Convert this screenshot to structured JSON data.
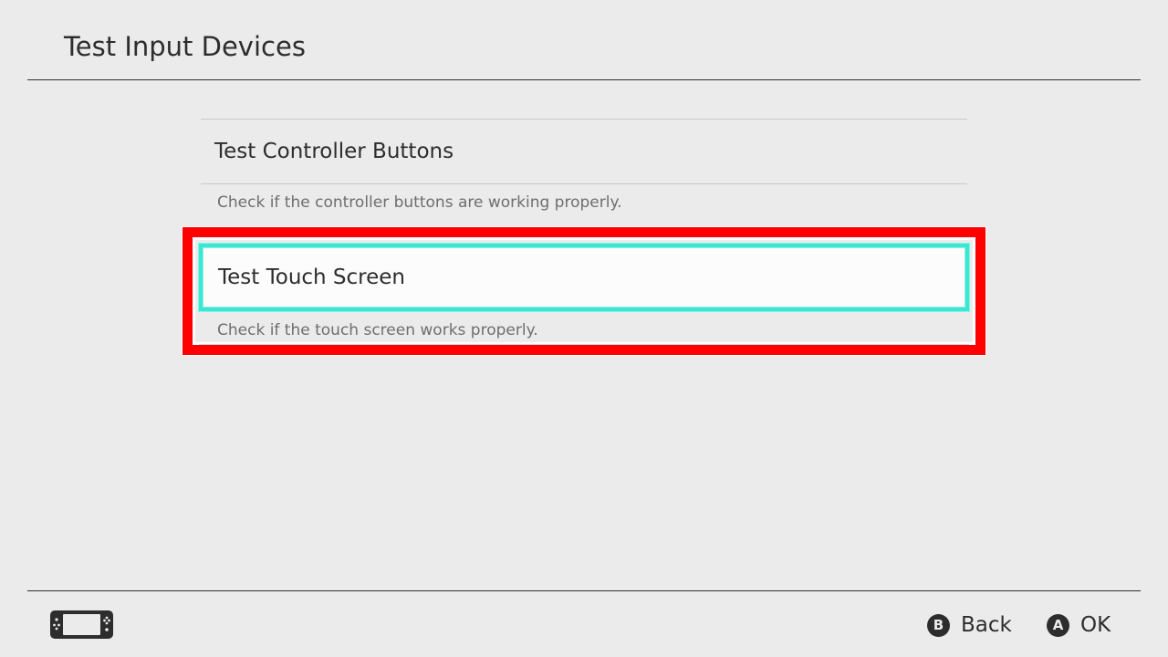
{
  "header": {
    "title": "Test Input Devices"
  },
  "menu": {
    "items": [
      {
        "label": "Test Controller Buttons",
        "description": "Check if the controller buttons are working properly."
      },
      {
        "label": "Test Touch Screen",
        "description": "Check if the touch screen works properly.",
        "selected": true
      }
    ]
  },
  "footer": {
    "mode_icon": "handheld-console-icon",
    "buttons": [
      {
        "glyph": "B",
        "label": "Back"
      },
      {
        "glyph": "A",
        "label": "OK"
      }
    ]
  },
  "colors": {
    "background": "#ebebeb",
    "text": "#2d2d2d",
    "secondary_text": "#6e6e6e",
    "selection_cursor": "#3be6d2",
    "annotation_highlight": "#ff0000"
  }
}
